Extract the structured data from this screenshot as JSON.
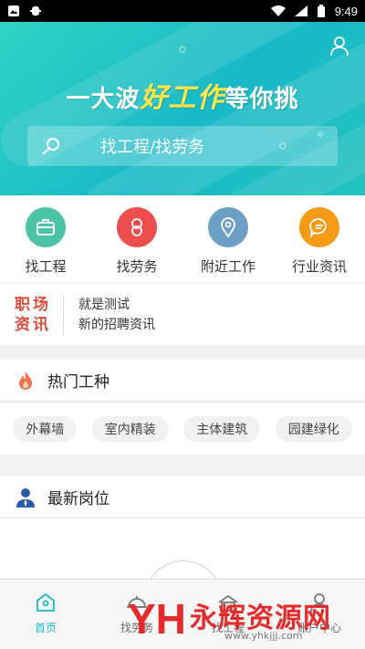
{
  "status_bar": {
    "time": "9:49"
  },
  "hero": {
    "slogan_prefix": "一大波",
    "slogan_highlight": "好工作",
    "slogan_suffix": "等你挑",
    "search_placeholder": "找工程/找劳务"
  },
  "categories": [
    {
      "label": "找工程",
      "icon": "briefcase-icon",
      "color": "#4cc3a6"
    },
    {
      "label": "找劳务",
      "icon": "worker-icon",
      "color": "#ee4d4d"
    },
    {
      "label": "附近工作",
      "icon": "location-pin-icon",
      "color": "#6d9fc4"
    },
    {
      "label": "行业资讯",
      "icon": "chat-bubble-icon",
      "color": "#f49a14"
    }
  ],
  "news": {
    "logo_line1": "职场",
    "logo_line2": "资讯",
    "items": [
      "就是测试",
      "新的招聘资讯"
    ]
  },
  "hot_jobs": {
    "title": "热门工种",
    "tags": [
      "外幕墙",
      "室内精装",
      "主体建筑",
      "园建绿化"
    ]
  },
  "latest": {
    "title": "最新岗位"
  },
  "tabbar": {
    "items": [
      {
        "label": "首页",
        "icon": "home-icon",
        "active": true
      },
      {
        "label": "找劳务",
        "icon": "helmet-icon",
        "active": false
      },
      {
        "label": "找工程",
        "icon": "building-icon",
        "active": false
      },
      {
        "label": "账户中心",
        "icon": "user-icon",
        "active": false
      }
    ]
  },
  "watermark": {
    "brand": "永辉资源网",
    "url": "www.yhkjjj.com",
    "logo_text": "YH"
  },
  "colors": {
    "accent": "#18b9c8",
    "highlight": "#ffe44a",
    "brand_red": "#e24a3b"
  }
}
